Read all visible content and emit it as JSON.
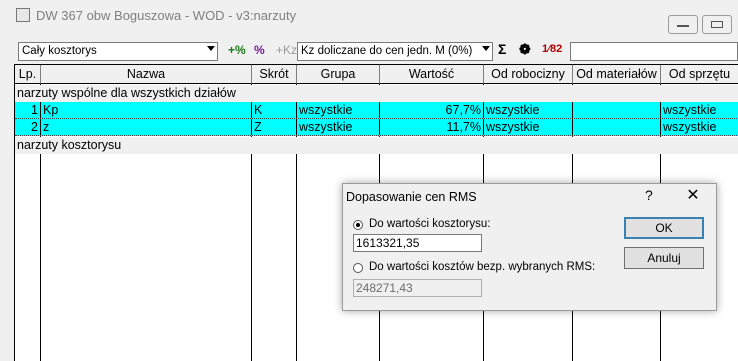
{
  "window": {
    "title": "DW 367 obw Boguszowa - WOD - v3:narzuty"
  },
  "toolbar": {
    "scope_value": "Cały kosztorys",
    "add_percent_icon": "+%",
    "percent_icon": "%",
    "add_kz_icon": "+Kz",
    "mode_value": "Kz doliczane do cen jedn. M (0%)",
    "sum_icon": "Σ",
    "gear_icon": "❁",
    "counter_icon": "1⁄82",
    "right_combo_value": ""
  },
  "table": {
    "columns": [
      "Lp.",
      "Nazwa",
      "Skrót",
      "Grupa",
      "Wartość",
      "Od robocizny",
      "Od materiałów",
      "Od sprzętu"
    ],
    "group_common": "narzuty wspólne dla wszystkich działów",
    "group_estimate": "narzuty kosztorysu",
    "rows": [
      {
        "lp": "1",
        "nazwa": "Kp",
        "skrot": "K",
        "grupa": "wszystkie",
        "wartosc": "67,7%",
        "od_robocizny": "wszystkie",
        "od_materialow": "",
        "od_sprzetu": "wszystkie"
      },
      {
        "lp": "2",
        "nazwa": "z",
        "skrot": "Z",
        "grupa": "wszystkie",
        "wartosc": "11,7%",
        "od_robocizny": "wszystkie",
        "od_materialow": "",
        "od_sprzetu": "wszystkie"
      }
    ]
  },
  "dialog": {
    "title": "Dopasowanie cen RMS",
    "help": "?",
    "close": "✕",
    "option1_label": "Do wartości kosztorysu:",
    "option1_value": "1613321,35",
    "option2_label": "Do wartości kosztów bezp. wybranych RMS:",
    "option2_value": "248271,43",
    "ok_label": "OK",
    "cancel_label": "Anuluj"
  },
  "colors": {
    "highlight_row": "#00ffff",
    "default_button_border": "#3c7fb1"
  }
}
